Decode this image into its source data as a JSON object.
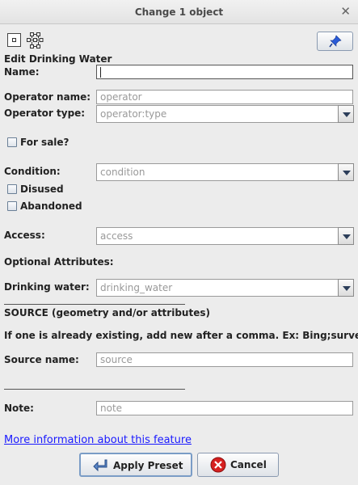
{
  "window": {
    "title": "Change 1 object",
    "close_glyph": "✕"
  },
  "header": {
    "node_icon": "node-icon",
    "preset_icon": "preset-icon",
    "pin_icon": "pin-icon",
    "heading": "Edit Drinking Water"
  },
  "form": {
    "name_label": "Name:",
    "name_value": "",
    "operator_name_label": "Operator name:",
    "operator_name_placeholder": "operator",
    "operator_type_label": "Operator type:",
    "operator_type_value": "operator:type",
    "for_sale_label": "For sale?",
    "condition_label": "Condition:",
    "condition_value": "condition",
    "disused_label": "Disused",
    "abandoned_label": "Abandoned",
    "access_label": "Access:",
    "access_value": "access",
    "optional_heading": "Optional Attributes:",
    "drinking_water_label": "Drinking water:",
    "drinking_water_value": "drinking_water",
    "source_heading": "SOURCE (geometry and/or attributes)",
    "source_hint": "If one is already existing, add new after a comma. Ex: Bing;survey",
    "source_name_label": "Source name:",
    "source_name_placeholder": "source",
    "note_label": "Note:",
    "note_placeholder": "note"
  },
  "footer": {
    "more_info_link": "More information about this feature",
    "apply_label": "Apply Preset",
    "cancel_label": "Cancel"
  },
  "colors": {
    "link": "#1a1aff",
    "cancel_icon": "#d62020",
    "pin_icon": "#2a5bd7"
  }
}
